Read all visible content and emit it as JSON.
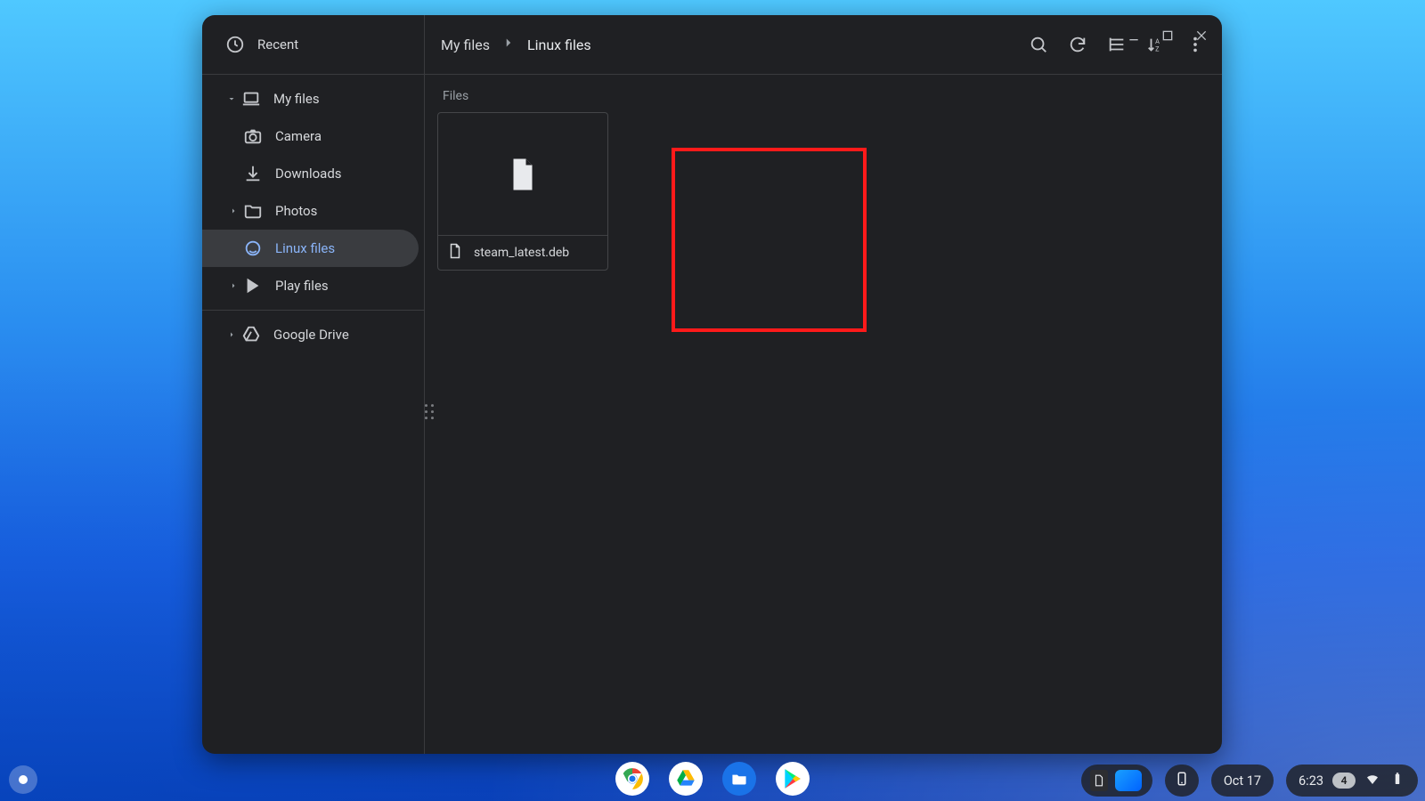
{
  "sidebar": {
    "recent_label": "Recent",
    "my_files_label": "My files",
    "camera_label": "Camera",
    "downloads_label": "Downloads",
    "photos_label": "Photos",
    "linux_label": "Linux files",
    "play_label": "Play files",
    "drive_label": "Google Drive"
  },
  "breadcrumb": {
    "root": "My files",
    "current": "Linux files"
  },
  "section_label": "Files",
  "files": [
    {
      "name": "steam_latest.deb",
      "icon": "file"
    }
  ],
  "status": {
    "date": "Oct 17",
    "time": "6:23",
    "notification_count": "4"
  }
}
